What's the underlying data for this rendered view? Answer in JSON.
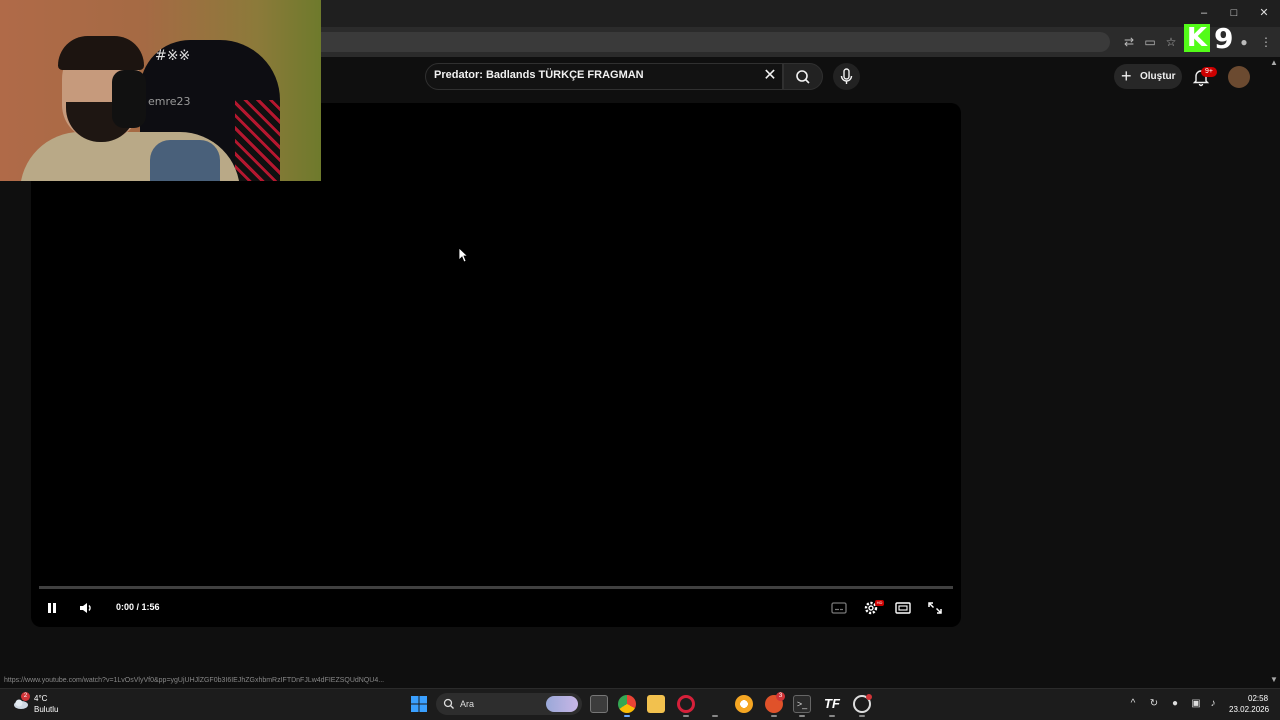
{
  "youtube": {
    "search_query": "Predator: Badlands TÜRKÇE FRAGMAN",
    "create_label": "Oluştur",
    "notification_badge": "9+"
  },
  "player": {
    "time_display": "0:00 / 1:56",
    "progress_fraction": 0.0,
    "quality_badge": "HD"
  },
  "status_bar": {
    "url": "https://www.youtube.com/watch?v=1LvOsVlyVf0&pp=ygUjUHJlZGF0b3I6IEJhZGxhbmRzIFTDnFJLw4dFIEZSQUdNQU4..."
  },
  "webcam": {
    "chair_brand": "emre23",
    "chair_logo": "#※※"
  },
  "stream_logo": {
    "letter": "K",
    "number": "9"
  },
  "taskbar": {
    "weather_temp": "4°C",
    "weather_desc": "Bulutlu",
    "weather_badge": "2",
    "search_label": "Ara",
    "clock_time": "02:58",
    "clock_date": "23.02.2026",
    "brave_badge": "3"
  },
  "colors": {
    "youtube_red": "#ff0000",
    "kick_green": "#53fc18",
    "page_bg": "#0f0f0f"
  }
}
